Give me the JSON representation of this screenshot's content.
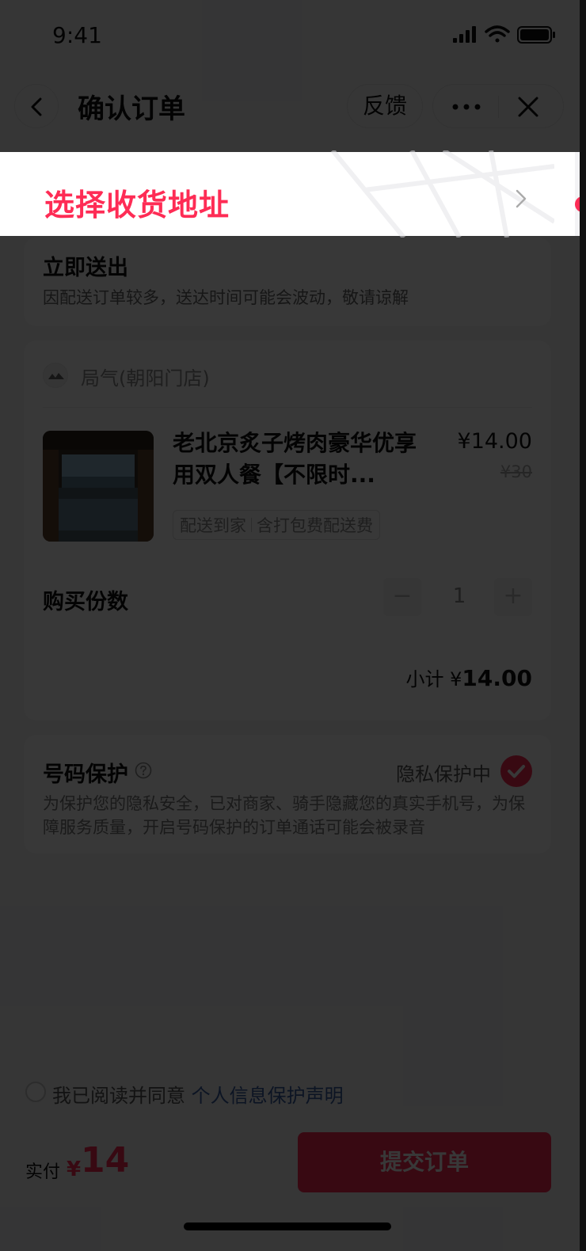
{
  "status_bar": {
    "time": "9:41"
  },
  "nav": {
    "title": "确认订单",
    "feedback_label": "反馈",
    "icons": [
      "back-arrow-icon",
      "more-dots-icon",
      "close-icon"
    ]
  },
  "address": {
    "label": "选择收货地址",
    "accent_color": "#fe2c55"
  },
  "delivery": {
    "title": "立即送出",
    "note": "因配送订单较多，送达时间可能会波动，敬请谅解"
  },
  "shop": {
    "name": "局气(朝阳门店)"
  },
  "product": {
    "title": "老北京炙子烤肉豪华优享用双人餐【不限时...",
    "price": "¥14.00",
    "original_price": "¥30",
    "tag_1": "配送到家",
    "tag_2": "含打包费配送费"
  },
  "quantity": {
    "label": "购买份数",
    "minus": "−",
    "value": "1",
    "plus": "+"
  },
  "subtotal": {
    "label": "小计 ¥",
    "amount": "14.00"
  },
  "protection": {
    "title": "号码保护",
    "state": "隐私保护中",
    "desc": "为保护您的隐私安全，已对商家、骑手隐藏您的真实手机号，为保障服务质量，开启号码保护的订单通话可能会被录音"
  },
  "agreement": {
    "text": "我已阅读并同意",
    "link": "个人信息保护声明"
  },
  "footer": {
    "pay_label": "实付",
    "currency": "¥",
    "amount": "14",
    "submit_label": "提交订单"
  }
}
